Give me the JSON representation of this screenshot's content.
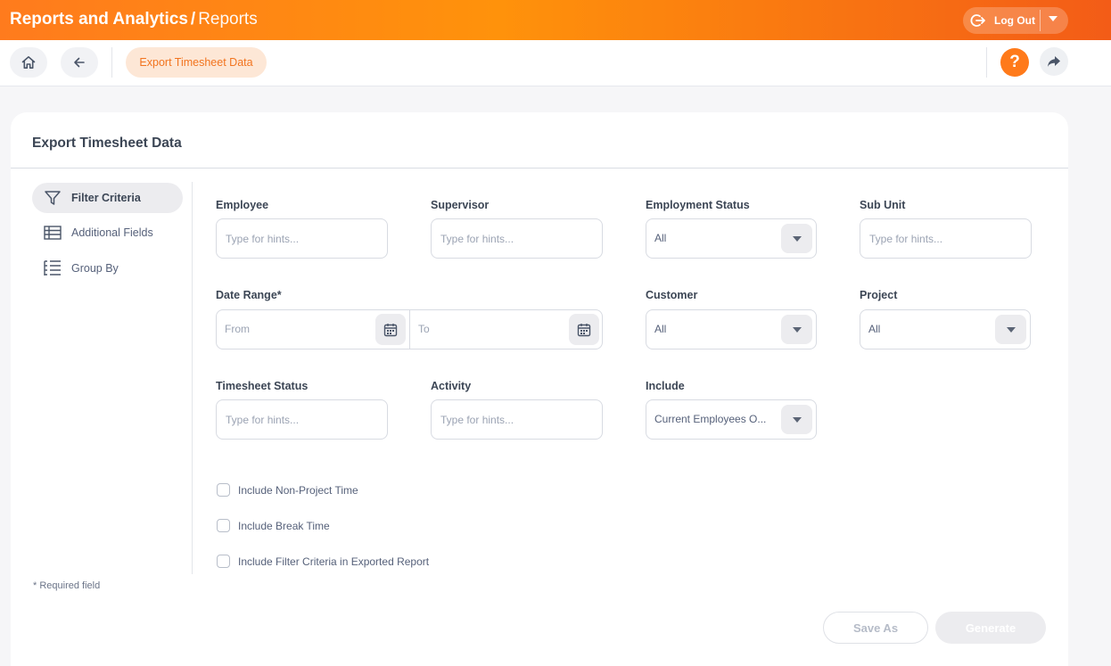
{
  "header": {
    "module": "Reports and Analytics",
    "separator": "/",
    "section": "Reports",
    "logout_label": "Log Out"
  },
  "navbar": {
    "breadcrumb_pill": "Export Timesheet Data",
    "help_label": "?"
  },
  "card": {
    "title": "Export Timesheet Data"
  },
  "sidebar": {
    "items": [
      {
        "label": "Filter Criteria",
        "icon": "filter-icon",
        "active": true
      },
      {
        "label": "Additional Fields",
        "icon": "table-icon",
        "active": false
      },
      {
        "label": "Group By",
        "icon": "list-tree-icon",
        "active": false
      }
    ]
  },
  "form": {
    "employee": {
      "label": "Employee",
      "placeholder": "Type for hints..."
    },
    "supervisor": {
      "label": "Supervisor",
      "placeholder": "Type for hints..."
    },
    "employment_status": {
      "label": "Employment Status",
      "value": "All"
    },
    "sub_unit": {
      "label": "Sub Unit",
      "placeholder": "Type for hints..."
    },
    "date_range": {
      "label": "Date Range*",
      "from_placeholder": "From",
      "to_placeholder": "To"
    },
    "customer": {
      "label": "Customer",
      "value": "All"
    },
    "project": {
      "label": "Project",
      "value": "All"
    },
    "timesheet_status": {
      "label": "Timesheet Status",
      "placeholder": "Type for hints..."
    },
    "activity": {
      "label": "Activity",
      "placeholder": "Type for hints..."
    },
    "include": {
      "label": "Include",
      "value": "Current Employees O..."
    },
    "checkboxes": [
      {
        "label": "Include Non-Project Time",
        "checked": false
      },
      {
        "label": "Include Break Time",
        "checked": false
      },
      {
        "label": "Include Filter Criteria in Exported Report",
        "checked": false
      }
    ],
    "required_note": "* Required field"
  },
  "actions": {
    "save_as": "Save As",
    "generate": "Generate"
  },
  "colors": {
    "brand_orange": "#ff7b1d",
    "accent_light": "#fde7d6",
    "muted_bg": "#ececef"
  }
}
